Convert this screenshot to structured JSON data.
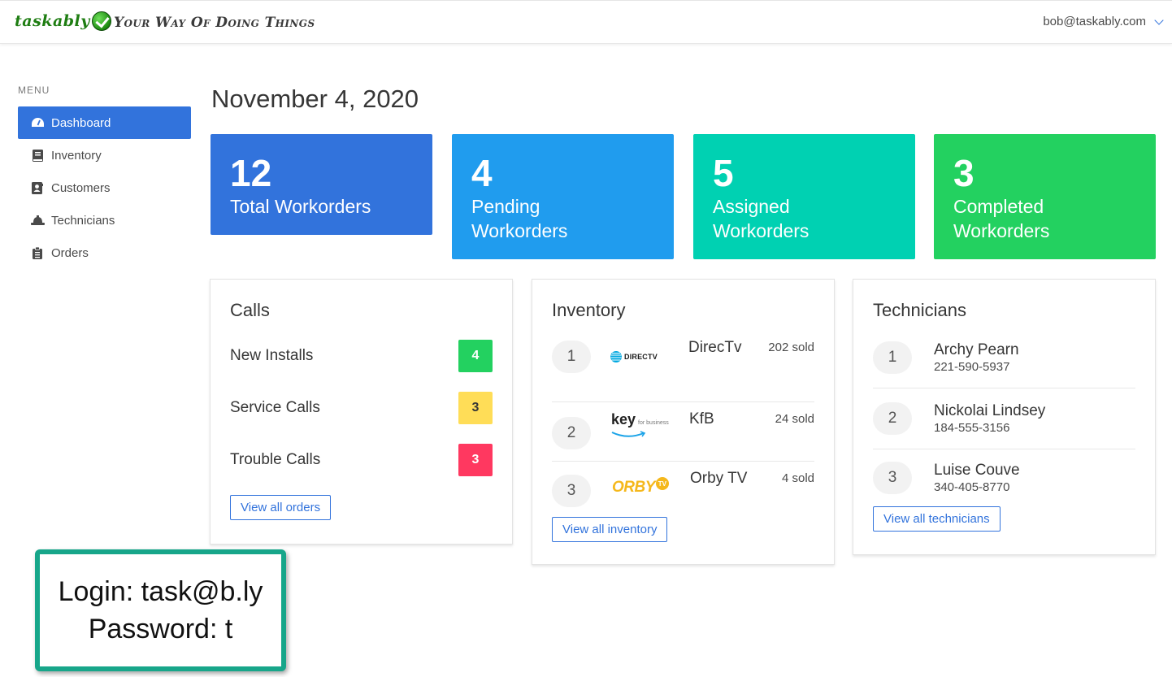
{
  "header": {
    "logo_text": "taskably",
    "tagline": "Your Way Of Doing Things",
    "user_email": "bob@taskably.com"
  },
  "sidebar": {
    "menu_label": "MENU",
    "items": [
      {
        "label": "Dashboard",
        "icon": "gauge-icon",
        "active": true
      },
      {
        "label": "Inventory",
        "icon": "book-icon",
        "active": false
      },
      {
        "label": "Customers",
        "icon": "address-book-icon",
        "active": false
      },
      {
        "label": "Technicians",
        "icon": "hard-hat-icon",
        "active": false
      },
      {
        "label": "Orders",
        "icon": "clipboard-icon",
        "active": false
      }
    ]
  },
  "main": {
    "date": "November 4, 2020",
    "stats": [
      {
        "value": "12",
        "label": "Total Workorders",
        "color": "#3273dc"
      },
      {
        "value": "4",
        "label": "Pending Workorders",
        "color": "#209cee"
      },
      {
        "value": "5",
        "label": "Assigned Workorders",
        "color": "#00d1b2"
      },
      {
        "value": "3",
        "label": "Completed Workorders",
        "color": "#23d160"
      }
    ],
    "calls": {
      "title": "Calls",
      "rows": [
        {
          "label": "New Installs",
          "count": "4",
          "color": "#23d160",
          "text_color": "#ffffff"
        },
        {
          "label": "Service Calls",
          "count": "3",
          "color": "#ffdd57",
          "text_color": "#363636"
        },
        {
          "label": "Trouble Calls",
          "count": "3",
          "color": "#ff3860",
          "text_color": "#ffffff"
        }
      ],
      "button": "View all orders"
    },
    "inventory": {
      "title": "Inventory",
      "rows": [
        {
          "rank": "1",
          "logo": "directv-logo",
          "logo_text": "DIRECTV",
          "name": "DirecTv",
          "sold": "202 sold"
        },
        {
          "rank": "2",
          "logo": "key-for-business-logo",
          "logo_text": "key",
          "logo_subtext": "for business",
          "name": "KfB",
          "sold": "24 sold"
        },
        {
          "rank": "3",
          "logo": "orby-tv-logo",
          "logo_text": "ORBY",
          "logo_subtext": "TV",
          "name": "Orby TV",
          "sold": "4 sold"
        }
      ],
      "button": "View all inventory"
    },
    "technicians": {
      "title": "Technicians",
      "rows": [
        {
          "rank": "1",
          "name": "Archy Pearn",
          "phone": "221-590-5937"
        },
        {
          "rank": "2",
          "name": "Nickolai Lindsey",
          "phone": "184-555-3156"
        },
        {
          "rank": "3",
          "name": "Luise Couve",
          "phone": "340-405-8770"
        }
      ],
      "button": "View all technicians"
    }
  },
  "login_note": {
    "line1": "Login: task@b.ly",
    "line2": "Password: t"
  }
}
